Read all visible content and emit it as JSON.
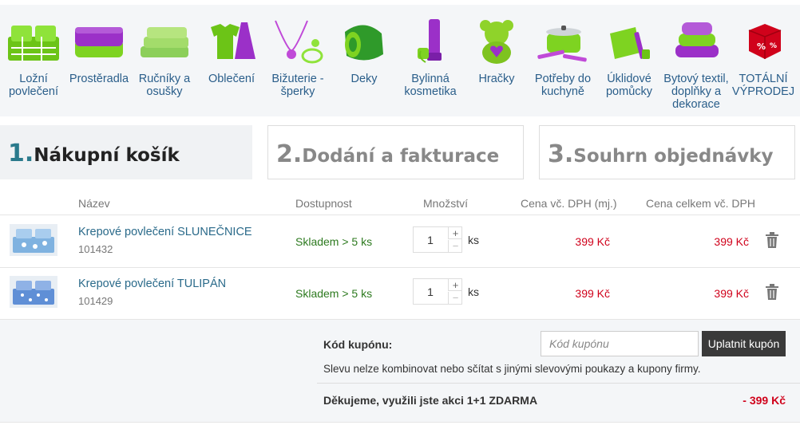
{
  "categories": [
    {
      "label": "Ložní povlečení",
      "icon": "bedding-icon"
    },
    {
      "label": "Prostěradla",
      "icon": "bedsheet-icon"
    },
    {
      "label": "Ručníky a osušky",
      "icon": "towels-icon"
    },
    {
      "label": "Oblečení",
      "icon": "clothing-icon"
    },
    {
      "label": "Bižuterie - šperky",
      "icon": "jewelry-icon"
    },
    {
      "label": "Deky",
      "icon": "blanket-icon"
    },
    {
      "label": "Bylinná kosmetika",
      "icon": "cosmetics-icon"
    },
    {
      "label": "Hračky",
      "icon": "teddy-bear-icon"
    },
    {
      "label": "Potřeby do kuchyně",
      "icon": "kitchen-pot-icon"
    },
    {
      "label": "Úklidové pomůcky",
      "icon": "dustpan-icon"
    },
    {
      "label": "Bytový textil, doplňky a dekorace",
      "icon": "pillows-icon"
    },
    {
      "label": "TOTÁLNÍ VÝPRODEJ",
      "icon": "sale-dice-icon"
    }
  ],
  "steps": [
    {
      "num": "1.",
      "label": "Nákupní košík"
    },
    {
      "num": "2.",
      "label": "Dodání a fakturace"
    },
    {
      "num": "3.",
      "label": "Souhrn objednávky"
    }
  ],
  "table": {
    "headers": {
      "name": "Název",
      "availability": "Dostupnost",
      "quantity": "Množství",
      "unit_price": "Cena vč. DPH (mj.)",
      "total_price": "Cena celkem vč. DPH"
    },
    "rows": [
      {
        "name": "Krepové povlečení SLUNEČNICE",
        "code": "101432",
        "availability": "Skladem > 5 ks",
        "qty": "1",
        "plus": "+",
        "minus": "−",
        "unit": "ks",
        "unit_price": "399 Kč",
        "total": "399 Kč"
      },
      {
        "name": "Krepové povlečení TULIPÁN",
        "code": "101429",
        "availability": "Skladem > 5 ks",
        "qty": "1",
        "plus": "+",
        "minus": "−",
        "unit": "ks",
        "unit_price": "399 Kč",
        "total": "399 Kč"
      }
    ]
  },
  "coupon": {
    "label": "Kód kupónu:",
    "placeholder": "Kód kupónu",
    "button": "Uplatnit kupón",
    "note": "Slevu nelze kombinovat nebo sčítat s jinými slevovými poukazy a kupony firmy.",
    "promo_text": "Děkujeme, využili jste akci 1+1 ZDARMA",
    "promo_value": "- 399 Kč"
  },
  "colors": {
    "accent_green": "#7ed321",
    "accent_purple": "#9b30c8",
    "link_blue": "#2a5e8a",
    "price_red": "#d0021b",
    "stock_green": "#2d7a1f"
  }
}
